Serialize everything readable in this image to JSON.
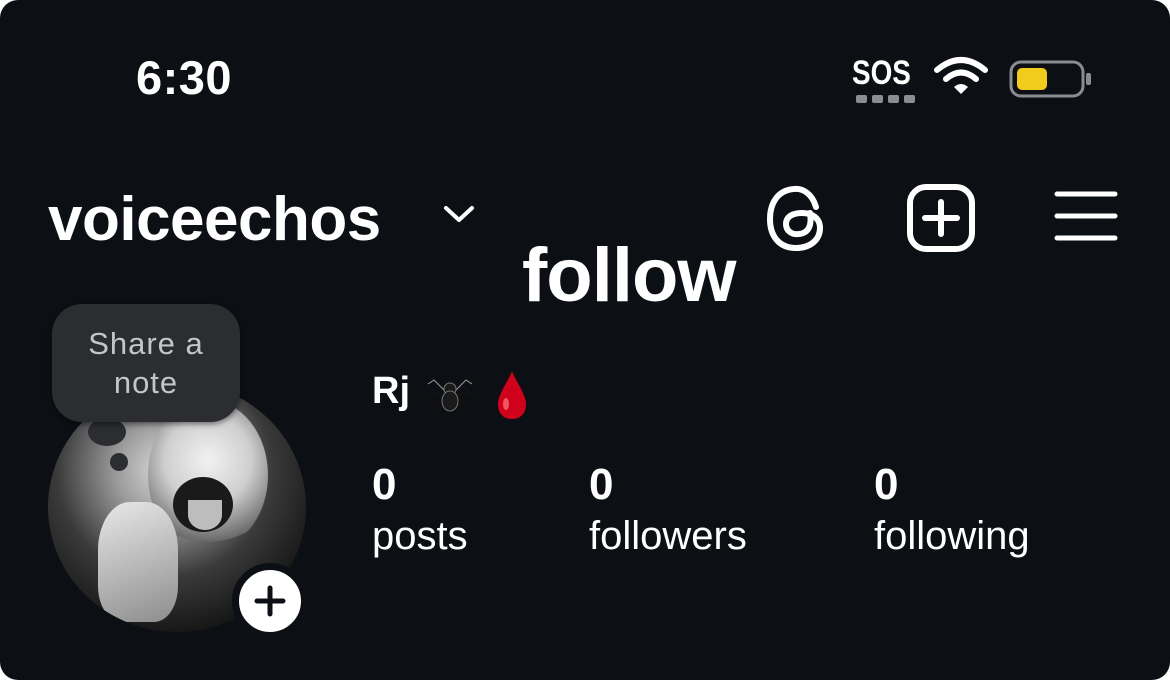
{
  "status_bar": {
    "time": "6:30",
    "carrier": "SOS",
    "battery_color": "#f2cc1b"
  },
  "header": {
    "username": "voiceechos",
    "icons": [
      "chevron-down-icon",
      "threads-icon",
      "add-post-icon",
      "menu-icon"
    ]
  },
  "overlay_text": "follow",
  "profile": {
    "note_prompt": "Share a note",
    "display_name": "Rj",
    "emoji": [
      "spider",
      "blood-drop"
    ],
    "stats": [
      {
        "value": "0",
        "label": "posts"
      },
      {
        "value": "0",
        "label": "followers"
      },
      {
        "value": "0",
        "label": "following"
      }
    ]
  },
  "colors": {
    "background": "#0c0f14",
    "text": "#ffffff",
    "note_bubble": "#2b2d31",
    "drop_red": "#d0021b"
  }
}
